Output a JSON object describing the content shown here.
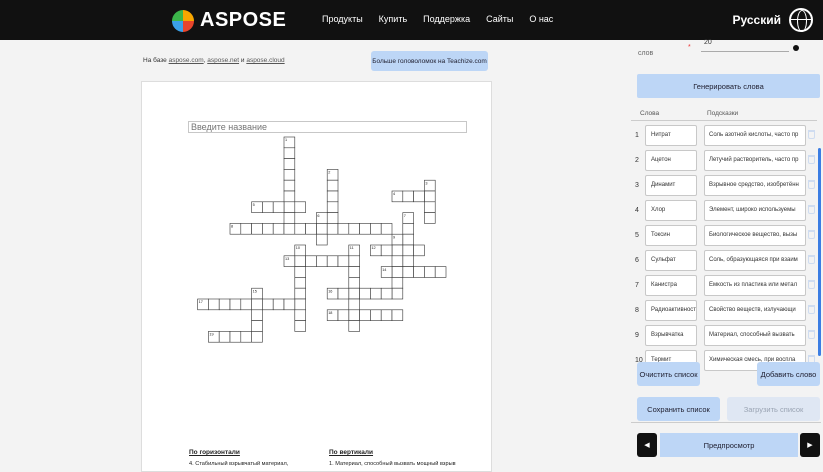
{
  "brand": {
    "name": "ASPOSE"
  },
  "nav": [
    "Продукты",
    "Купить",
    "Поддержка",
    "Сайты",
    "О нас"
  ],
  "language": "Русский",
  "based_on": {
    "prefix": "На базе",
    "links": [
      "aspose.com",
      "aspose.net",
      "aspose.cloud"
    ],
    "joiner": "и"
  },
  "teachize_button": "Больше головоломок на Teachize.com",
  "puzzle_title_placeholder": "Введите название",
  "clues": {
    "across_head": "По горизонтали",
    "across_first": "4. Стабильный взрывчатый материал,",
    "down_head": "По вертикали",
    "down_first": "1. Материал, способный вызвать мощный взрыв"
  },
  "panel": {
    "words_count_label": "слов",
    "words_count_value": "20",
    "generate_button": "Генерировать слова",
    "col_words": "Слова",
    "col_hints": "Подсказки",
    "rows": [
      {
        "num": "1",
        "word": "Нитрат",
        "hint": "Соль азотной кислоты, часто пр"
      },
      {
        "num": "2",
        "word": "Ацетон",
        "hint": "Летучий растворитель, часто пр"
      },
      {
        "num": "3",
        "word": "Динамит",
        "hint": "Взрывное средство, изобретённ"
      },
      {
        "num": "4",
        "word": "Хлор",
        "hint": "Элемент, широко используемы"
      },
      {
        "num": "5",
        "word": "Токсин",
        "hint": "Биологическое вещество, вызы"
      },
      {
        "num": "6",
        "word": "Сульфат",
        "hint": "Соль, образующаяся при взаим"
      },
      {
        "num": "7",
        "word": "Канистра",
        "hint": "Емкость из пластика или метал"
      },
      {
        "num": "8",
        "word": "Радиоактивность",
        "hint": "Свойство веществ, излучающи"
      },
      {
        "num": "9",
        "word": "Взрывчатка",
        "hint": "Материал, способный вызвать"
      },
      {
        "num": "10",
        "word": "Термит",
        "hint": "Химическая смесь, при воспла"
      }
    ],
    "clear_button": "Очистить список",
    "add_button": "Добавить слово",
    "save_button": "Сохранить список",
    "load_button": "Загрузить список",
    "preview_button": "Предпросмотр",
    "prev_arrow": "◀",
    "next_arrow": "▶"
  },
  "crossword": {
    "words": [
      {
        "n": "1",
        "dir": "down",
        "col": 5,
        "row": 0,
        "len": 8
      },
      {
        "n": "2",
        "dir": "down",
        "col": 9,
        "row": 3,
        "len": 5
      },
      {
        "n": "3",
        "dir": "down",
        "col": 18,
        "row": 4,
        "len": 4
      },
      {
        "n": "4",
        "dir": "across",
        "col": 15,
        "row": 5,
        "len": 4
      },
      {
        "n": "5",
        "dir": "across",
        "col": 2,
        "row": 6,
        "len": 5
      },
      {
        "n": "6",
        "dir": "down",
        "col": 8,
        "row": 7,
        "len": 3
      },
      {
        "n": "7",
        "dir": "down",
        "col": 16,
        "row": 7,
        "len": 6
      },
      {
        "n": "8",
        "dir": "across",
        "col": 0,
        "row": 8,
        "len": 15
      },
      {
        "n": "9",
        "dir": "down",
        "col": 15,
        "row": 9,
        "len": 6
      },
      {
        "n": "10",
        "dir": "down",
        "col": 6,
        "row": 10,
        "len": 8
      },
      {
        "n": "11",
        "dir": "down",
        "col": 11,
        "row": 10,
        "len": 8
      },
      {
        "n": "12",
        "dir": "across",
        "col": 13,
        "row": 10,
        "len": 5
      },
      {
        "n": "13",
        "dir": "across",
        "col": 5,
        "row": 11,
        "len": 7
      },
      {
        "n": "14",
        "dir": "across",
        "col": 14,
        "row": 12,
        "len": 6
      },
      {
        "n": "15",
        "dir": "down",
        "col": 2,
        "row": 14,
        "len": 5
      },
      {
        "n": "16",
        "dir": "across",
        "col": 9,
        "row": 14,
        "len": 6
      },
      {
        "n": "17",
        "dir": "across",
        "col": -3,
        "row": 15,
        "len": 9
      },
      {
        "n": "18",
        "dir": "across",
        "col": 9,
        "row": 16,
        "len": 7
      },
      {
        "n": "19",
        "dir": "across",
        "col": -2,
        "row": 18,
        "len": 5
      }
    ]
  }
}
